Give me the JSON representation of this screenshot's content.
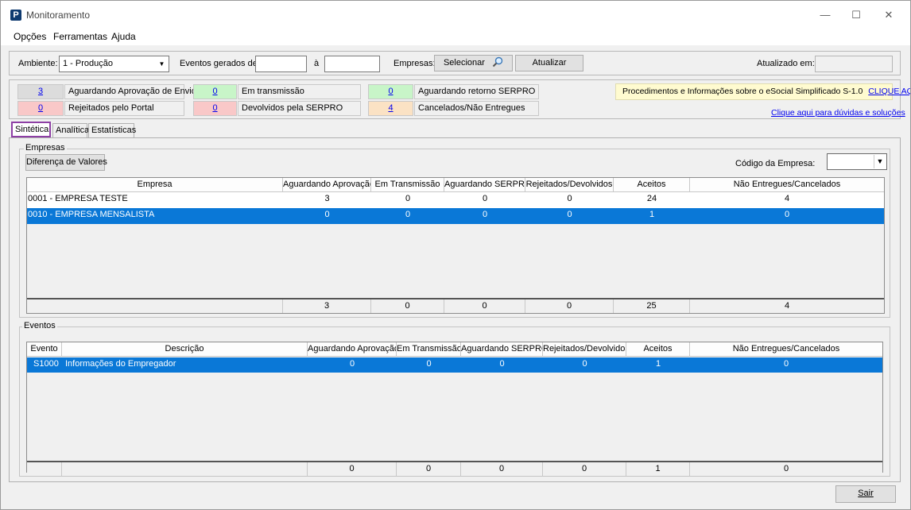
{
  "window": {
    "title": "Monitoramento",
    "app_icon": "P",
    "controls": {
      "minimize": "—",
      "maximize": "☐",
      "close": "✕"
    }
  },
  "menu": [
    "Opções",
    "Ferramentas",
    "Ajuda"
  ],
  "toolbar": {
    "ambiente_label": "Ambiente:",
    "ambiente_value": "1 - Produção",
    "eventos_label": "Eventos gerados de:",
    "a_label": "à",
    "empresas_label": "Empresas:",
    "selecionar_label": "Selecionar",
    "atualizar_label": "Atualizar",
    "atualizado_label": "Atualizado em:"
  },
  "counters": [
    {
      "value": "3",
      "label": "Aguardando Aprovação de Envio",
      "color": "#dcdcdc"
    },
    {
      "value": "0",
      "label": "Em transmissão",
      "color": "#c8f5c8"
    },
    {
      "value": "0",
      "label": "Aguardando retorno SERPRO",
      "color": "#c8f5c8"
    },
    {
      "value": "0",
      "label": "Rejeitados pelo Portal",
      "color": "#f9c8c8"
    },
    {
      "value": "0",
      "label": "Devolvidos pela SERPRO",
      "color": "#f9c8c8"
    },
    {
      "value": "4",
      "label": "Cancelados/Não Entregues",
      "color": "#fbe2c4"
    }
  ],
  "info": {
    "text": "Procedimentos e Informações sobre o eSocial Simplificado S-1.0",
    "link": "CLIQUE AQUI",
    "help_link": "Clique aqui para dúvidas e soluções"
  },
  "tabs": [
    "Sintética",
    "Analítica",
    "Estatísticas"
  ],
  "empresas": {
    "group_title": "Empresas",
    "diff_button": "Diferença de Valores",
    "codigo_label": "Código da Empresa:",
    "columns": [
      "Empresa",
      "Aguardando Aprovação",
      "Em Transmissão",
      "Aguardando SERPRO",
      "Rejeitados/Devolvidos",
      "Aceitos",
      "Não Entregues/Cancelados"
    ],
    "rows": [
      [
        "0001 - EMPRESA TESTE",
        "3",
        "0",
        "0",
        "0",
        "24",
        "4"
      ],
      [
        "0010 - EMPRESA MENSALISTA",
        "0",
        "0",
        "0",
        "0",
        "1",
        "0"
      ]
    ],
    "totals": [
      "",
      "3",
      "0",
      "0",
      "0",
      "25",
      "4"
    ]
  },
  "eventos": {
    "group_title": "Eventos",
    "columns": [
      "Evento",
      "Descrição",
      "Aguardando Aprovação",
      "Em Transmissão",
      "Aguardando SERPRO",
      "Rejeitados/Devolvidos",
      "Aceitos",
      "Não Entregues/Cancelados"
    ],
    "rows": [
      [
        "S1000",
        "Informações do Empregador",
        "0",
        "0",
        "0",
        "0",
        "1",
        "0"
      ]
    ],
    "totals": [
      "",
      "",
      "0",
      "0",
      "0",
      "0",
      "1",
      "0"
    ]
  },
  "footer": {
    "sair_label": "Sair"
  }
}
